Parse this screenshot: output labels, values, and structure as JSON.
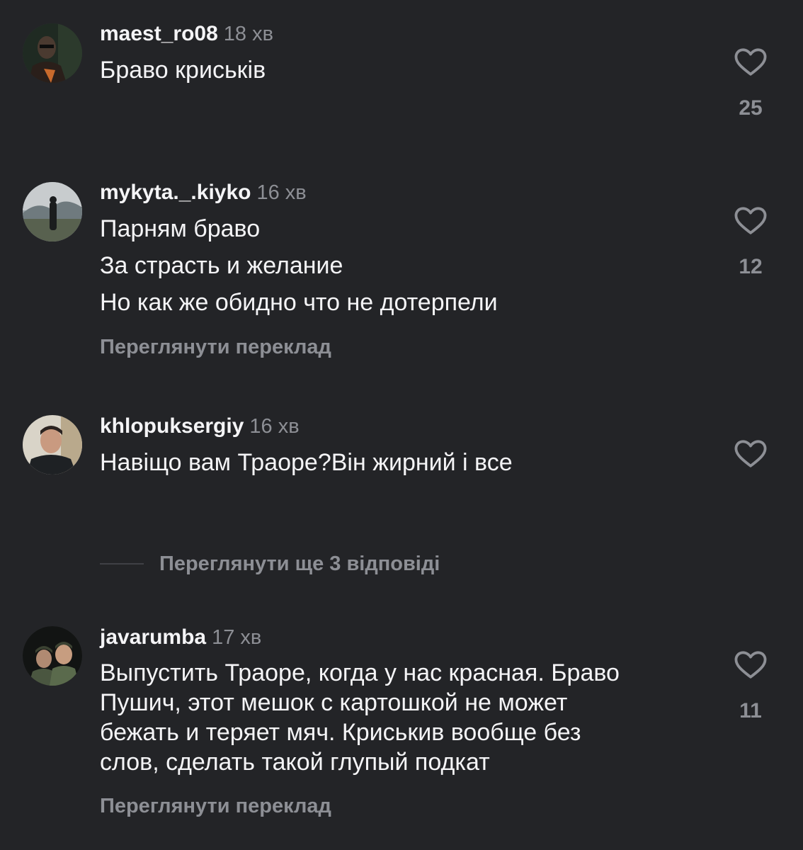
{
  "comments": [
    {
      "username": "maest_ro08",
      "time": "18 хв",
      "lines": [
        "Браво криськів"
      ],
      "likes": "25",
      "avatar_icon": "dark-portrait-avatar"
    },
    {
      "username": "mykyta._.kiyko",
      "time": "16 хв",
      "lines": [
        "Парням браво",
        "За страсть и желание",
        "Но как же обидно что не дотерпели"
      ],
      "likes": "12",
      "translate_label": "Переглянути переклад",
      "avatar_icon": "landscape-silhouette-avatar"
    },
    {
      "username": "khlopuksergiy",
      "time": "16 хв",
      "lines": [
        "Навіщо вам Траоре?Він жирний і все"
      ],
      "likes": "",
      "avatar_icon": "selfie-avatar"
    },
    {
      "username": "javarumba",
      "time": "17 хв",
      "lines": [
        "Выпустить Траоре, когда у нас красная. Браво",
        "Пушич, этот мешок с картошкой не может",
        "бежать и теряет мяч. Криськив вообще без",
        "слов, сделать такой глупый подкат"
      ],
      "likes": "11",
      "translate_label": "Переглянути переклад",
      "avatar_icon": "two-soldiers-avatar"
    }
  ],
  "view_replies_label": "Переглянути ще 3 відповіді",
  "colors": {
    "background": "#232427",
    "text_primary": "#f4f4f6",
    "text_secondary": "#8d8f95"
  },
  "icons": {
    "like": "heart-outline-icon"
  }
}
